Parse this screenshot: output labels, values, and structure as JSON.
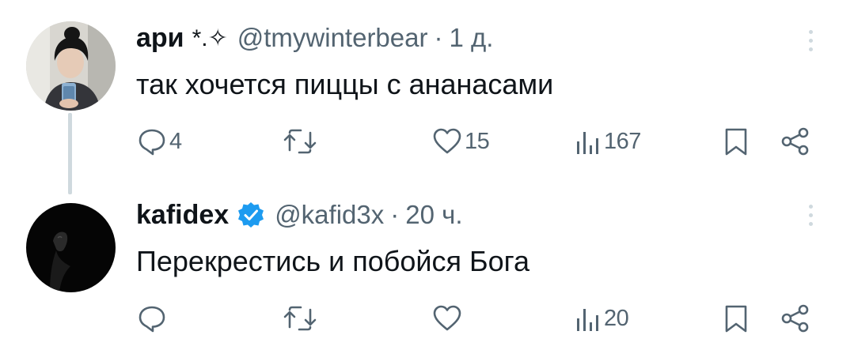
{
  "tweets": [
    {
      "display_name": "ари",
      "name_decoration": "*.✧",
      "verified": false,
      "handle": "@tmywinterbear",
      "time": "1 д.",
      "text": "так хочется пиццы с ананасами",
      "actions": {
        "replies": "4",
        "retweets": "",
        "likes": "15",
        "views": "167"
      }
    },
    {
      "display_name": "kafidex",
      "name_decoration": "",
      "verified": true,
      "handle": "@kafid3x",
      "time": "20 ч.",
      "text": "Перекрестись и побойся Бога",
      "actions": {
        "replies": "",
        "retweets": "",
        "likes": "",
        "views": "20"
      }
    }
  ],
  "separator": "·",
  "icons": {
    "reply": "reply-icon",
    "retweet": "retweet-icon",
    "like": "heart-icon",
    "views": "views-icon",
    "bookmark": "bookmark-icon",
    "share": "share-icon",
    "more": "more-icon",
    "verified": "verified-badge-icon"
  },
  "colors": {
    "text": "#0f1419",
    "secondary": "#536471",
    "verified": "#1d9bf0",
    "thread_line": "#cfd9de"
  }
}
